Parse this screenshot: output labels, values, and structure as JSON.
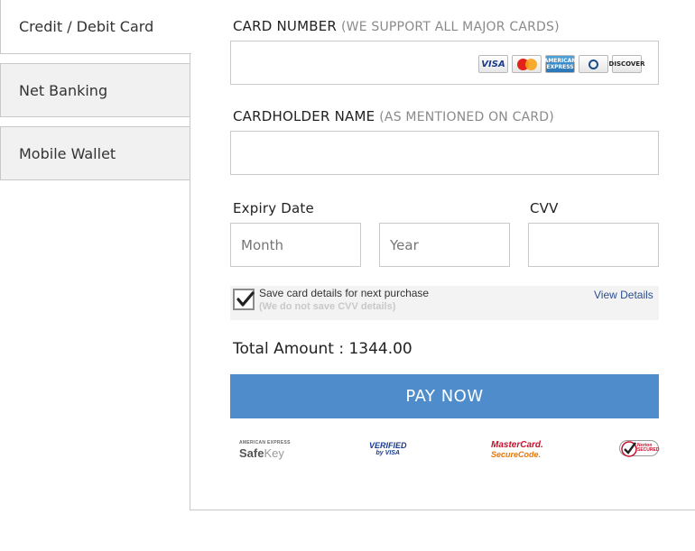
{
  "sidebar": {
    "tabs": [
      {
        "label": "Credit / Debit Card",
        "active": true
      },
      {
        "label": "Net Banking",
        "active": false
      },
      {
        "label": "Mobile Wallet",
        "active": false
      }
    ]
  },
  "form": {
    "card_number": {
      "label": "CARD NUMBER",
      "sublabel": "(WE SUPPORT ALL MAJOR CARDS)",
      "value": "",
      "card_logos": [
        "VISA",
        "MasterCard",
        "American Express",
        "Diners Club",
        "DISCOVER"
      ]
    },
    "cardholder": {
      "label": "CARDHOLDER NAME",
      "sublabel": "(AS MENTIONED ON CARD)",
      "value": ""
    },
    "expiry": {
      "label": "Expiry Date",
      "month_placeholder": "Month",
      "year_placeholder": "Year"
    },
    "cvv": {
      "label": "CVV",
      "value": ""
    },
    "save_card": {
      "checked": true,
      "text": "Save card details for next purchase",
      "note": "(We do not save CVV details)",
      "view_details": "View Details"
    }
  },
  "total": {
    "text": "Total Amount : 1344.00"
  },
  "pay_button": {
    "label": "PAY NOW"
  },
  "badges": {
    "safekey_small": "AMERICAN EXPRESS",
    "safekey_a": "Safe",
    "safekey_b": "Key",
    "vbv_1": "VERIFIED",
    "vbv_2": "by VISA",
    "mcsc_1": "MasterCard.",
    "mcsc_2": "SecureCode.",
    "norton_1": "Norton",
    "norton_2": "SECURED"
  },
  "colors": {
    "accent": "#4e8ccc",
    "link": "#2d4e8c"
  }
}
